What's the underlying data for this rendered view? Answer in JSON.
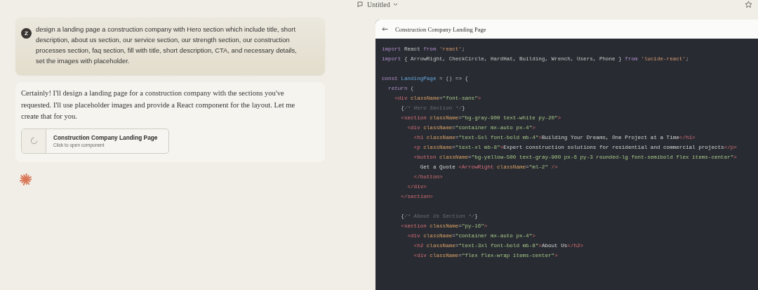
{
  "top_bar": {
    "title": "Untitled"
  },
  "conversation": [
    {
      "kind": "user",
      "avatar": "Z",
      "text": "design a landing page a construction company with Hero section which include title, short description, about us section, our service section, our strength section, our construction processes section, faq section, fill with title, short description, CTA, and necessary details, set the images with placeholder."
    },
    {
      "kind": "assistant",
      "text": "Certainly! I'll design a landing page for a construction company with the sections you've requested. I'll use placeholder images and provide a React component for the layout. Let me create that for you.",
      "artifact": {
        "title": "Construction Company Landing Page",
        "subtitle": "Click to open component"
      }
    }
  ],
  "code_panel": {
    "title": "Construction Company Landing Page",
    "lines": [
      {
        "segments": [
          {
            "kind": "keyword",
            "text": "import"
          },
          {
            "kind": "plain",
            "text": " React "
          },
          {
            "kind": "keyword",
            "text": "from"
          },
          {
            "kind": "string",
            "text": " 'react'"
          },
          {
            "kind": "plain",
            "text": ";"
          }
        ]
      },
      {
        "segments": [
          {
            "kind": "keyword",
            "text": "import"
          },
          {
            "kind": "plain",
            "text": " { ArrowRight, CheckCircle, HardHat, Building, Wrench, Users, Phone } "
          },
          {
            "kind": "keyword",
            "text": "from"
          },
          {
            "kind": "string",
            "text": " 'lucide-react'"
          },
          {
            "kind": "plain",
            "text": ";"
          }
        ]
      },
      {
        "gap_before": true,
        "segments": [
          {
            "kind": "keyword",
            "text": "const"
          },
          {
            "kind": "function",
            "text": " LandingPage"
          },
          {
            "kind": "plain",
            "text": " = () => {"
          }
        ]
      },
      {
        "segments": [
          {
            "kind": "keyword",
            "text": "  return"
          },
          {
            "kind": "plain",
            "text": " ("
          }
        ]
      },
      {
        "segments": [
          {
            "kind": "tag",
            "text": "    <div"
          },
          {
            "kind": "attr",
            "text": " className"
          },
          {
            "kind": "plain",
            "text": "="
          },
          {
            "kind": "value",
            "text": "\"font-sans\""
          },
          {
            "kind": "tag",
            "text": ">"
          }
        ]
      },
      {
        "segments": [
          {
            "kind": "plain",
            "text": "      {"
          },
          {
            "kind": "comment",
            "text": "/* Hero Section */"
          },
          {
            "kind": "plain",
            "text": "}"
          }
        ]
      },
      {
        "segments": [
          {
            "kind": "tag",
            "text": "      <section"
          },
          {
            "kind": "attr",
            "text": " className"
          },
          {
            "kind": "plain",
            "text": "="
          },
          {
            "kind": "value",
            "text": "\"bg-gray-900 text-white py-20\""
          },
          {
            "kind": "tag",
            "text": ">"
          }
        ]
      },
      {
        "segments": [
          {
            "kind": "tag",
            "text": "        <div"
          },
          {
            "kind": "attr",
            "text": " className"
          },
          {
            "kind": "plain",
            "text": "="
          },
          {
            "kind": "value",
            "text": "\"container mx-auto px-4\""
          },
          {
            "kind": "tag",
            "text": ">"
          }
        ]
      },
      {
        "segments": [
          {
            "kind": "tag",
            "text": "          <h1"
          },
          {
            "kind": "attr",
            "text": " className"
          },
          {
            "kind": "plain",
            "text": "="
          },
          {
            "kind": "value",
            "text": "\"text-5xl font-bold mb-4\""
          },
          {
            "kind": "tag",
            "text": ">"
          },
          {
            "kind": "text",
            "text": "Building Your Dreams, One Project at a Time"
          },
          {
            "kind": "tag",
            "text": "</h1>"
          }
        ]
      },
      {
        "segments": [
          {
            "kind": "tag",
            "text": "          <p"
          },
          {
            "kind": "attr",
            "text": " className"
          },
          {
            "kind": "plain",
            "text": "="
          },
          {
            "kind": "value",
            "text": "\"text-xl mb-8\""
          },
          {
            "kind": "tag",
            "text": ">"
          },
          {
            "kind": "text",
            "text": "Expert construction solutions for residential and commercial projects"
          },
          {
            "kind": "tag",
            "text": "</p>"
          }
        ]
      },
      {
        "segments": [
          {
            "kind": "tag",
            "text": "          <button"
          },
          {
            "kind": "attr",
            "text": " className"
          },
          {
            "kind": "plain",
            "text": "="
          },
          {
            "kind": "value",
            "text": "\"bg-yellow-500 text-gray-900 px-6 py-3 rounded-lg font-semibold flex items-center\""
          },
          {
            "kind": "tag",
            "text": ">"
          }
        ]
      },
      {
        "segments": [
          {
            "kind": "text",
            "text": "            Get a Quote"
          },
          {
            "kind": "tag",
            "text": " <ArrowRight"
          },
          {
            "kind": "attr",
            "text": " className"
          },
          {
            "kind": "plain",
            "text": "="
          },
          {
            "kind": "value",
            "text": "\"ml-2\""
          },
          {
            "kind": "tag",
            "text": " />"
          }
        ]
      },
      {
        "segments": [
          {
            "kind": "tag",
            "text": "          </button>"
          }
        ]
      },
      {
        "segments": [
          {
            "kind": "tag",
            "text": "        </div>"
          }
        ]
      },
      {
        "segments": [
          {
            "kind": "tag",
            "text": "      </section>"
          }
        ]
      },
      {
        "gap_before": true,
        "segments": [
          {
            "kind": "plain",
            "text": "      {"
          },
          {
            "kind": "comment",
            "text": "/* About Us Section */"
          },
          {
            "kind": "plain",
            "text": "}"
          }
        ]
      },
      {
        "segments": [
          {
            "kind": "tag",
            "text": "      <section"
          },
          {
            "kind": "attr",
            "text": " className"
          },
          {
            "kind": "plain",
            "text": "="
          },
          {
            "kind": "value",
            "text": "\"py-16\""
          },
          {
            "kind": "tag",
            "text": ">"
          }
        ]
      },
      {
        "segments": [
          {
            "kind": "tag",
            "text": "        <div"
          },
          {
            "kind": "attr",
            "text": " className"
          },
          {
            "kind": "plain",
            "text": "="
          },
          {
            "kind": "value",
            "text": "\"container mx-auto px-4\""
          },
          {
            "kind": "tag",
            "text": ">"
          }
        ]
      },
      {
        "segments": [
          {
            "kind": "tag",
            "text": "          <h2"
          },
          {
            "kind": "attr",
            "text": " className"
          },
          {
            "kind": "plain",
            "text": "="
          },
          {
            "kind": "value",
            "text": "\"text-3xl font-bold mb-8\""
          },
          {
            "kind": "tag",
            "text": ">"
          },
          {
            "kind": "text",
            "text": "About Us"
          },
          {
            "kind": "tag",
            "text": "</h2>"
          }
        ]
      },
      {
        "segments": [
          {
            "kind": "tag",
            "text": "          <div"
          },
          {
            "kind": "attr",
            "text": " className"
          },
          {
            "kind": "plain",
            "text": "="
          },
          {
            "kind": "value",
            "text": "\"flex flex-wrap items-center\""
          },
          {
            "kind": "tag",
            "text": ">"
          }
        ]
      }
    ]
  }
}
